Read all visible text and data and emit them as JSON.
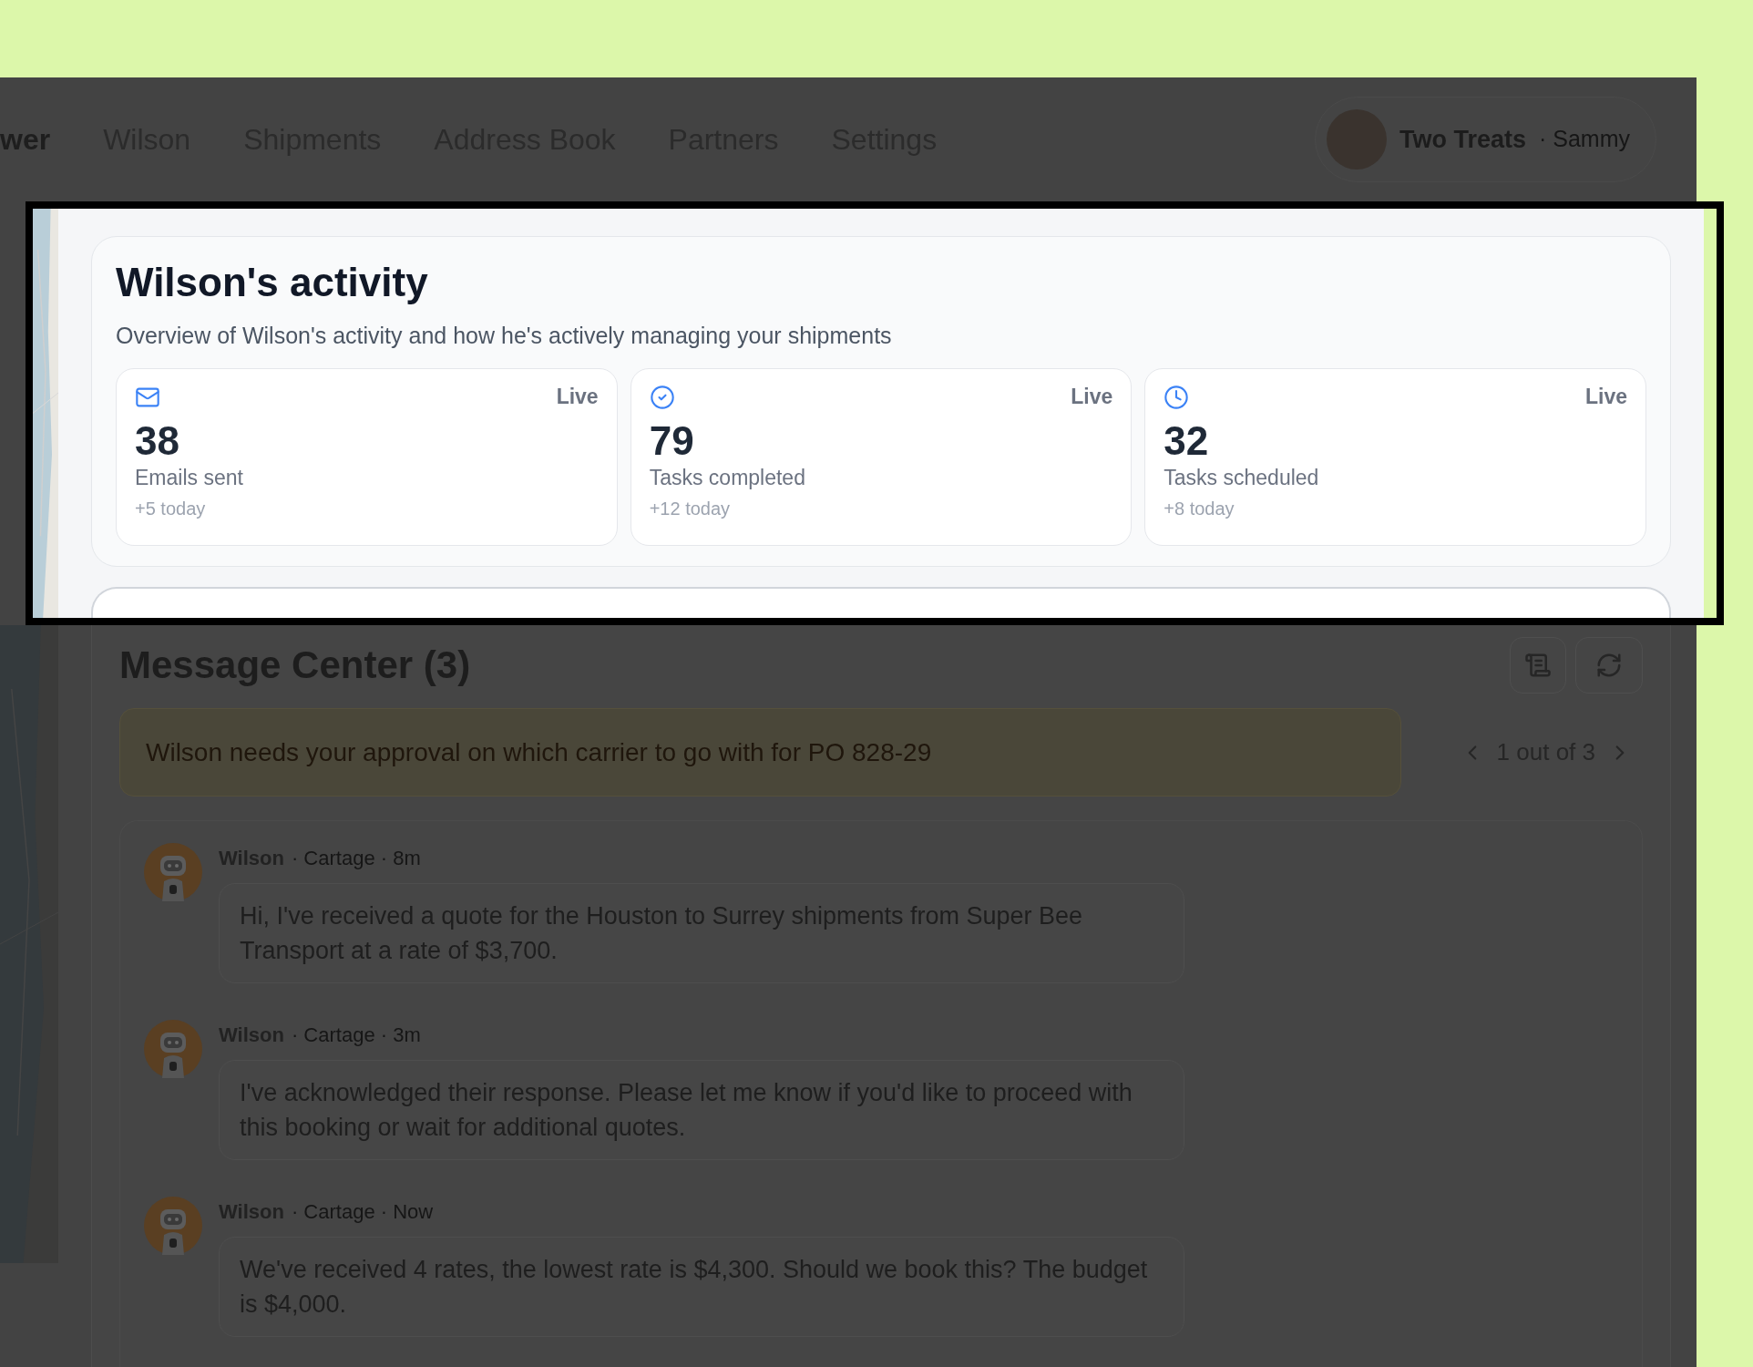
{
  "nav": {
    "items": [
      {
        "label": "wer",
        "selected": true
      },
      {
        "label": "Wilson",
        "selected": false
      },
      {
        "label": "Shipments",
        "selected": false
      },
      {
        "label": "Address Book",
        "selected": false
      },
      {
        "label": "Partners",
        "selected": false
      },
      {
        "label": "Settings",
        "selected": false
      }
    ],
    "account": {
      "org": "Two Treats",
      "user": "· Sammy"
    }
  },
  "activity": {
    "title": "Wilson's activity",
    "subtitle": "Overview of Wilson's activity and how he's actively managing your shipments",
    "stats": [
      {
        "kind": "mail",
        "value": "38",
        "label": "Emails sent",
        "status": "Live",
        "delta": "+5 today"
      },
      {
        "kind": "check",
        "value": "79",
        "label": "Tasks completed",
        "status": "Live",
        "delta": "+12 today"
      },
      {
        "kind": "clock",
        "value": "32",
        "label": "Tasks scheduled",
        "status": "Live",
        "delta": "+8 today"
      }
    ]
  },
  "message_center": {
    "title": "Message Center (3)",
    "alert": "Wilson needs your approval on which carrier to go with for PO 828-29",
    "pager": "1 out of 3",
    "messages": [
      {
        "sender": "Wilson",
        "meta": "· Cartage · 8m",
        "text": "Hi, I've received a quote for the Houston to Surrey shipments from Super Bee Transport at a rate of $3,700."
      },
      {
        "sender": "Wilson",
        "meta": "· Cartage · 3m",
        "text": "I've acknowledged their response. Please let me know if you'd like to proceed with this booking or wait for additional quotes."
      },
      {
        "sender": "Wilson",
        "meta": "· Cartage · Now",
        "text": "We've received 4 rates, the lowest rate is $4,300. Should we book this? The budget is $4,000."
      }
    ]
  }
}
